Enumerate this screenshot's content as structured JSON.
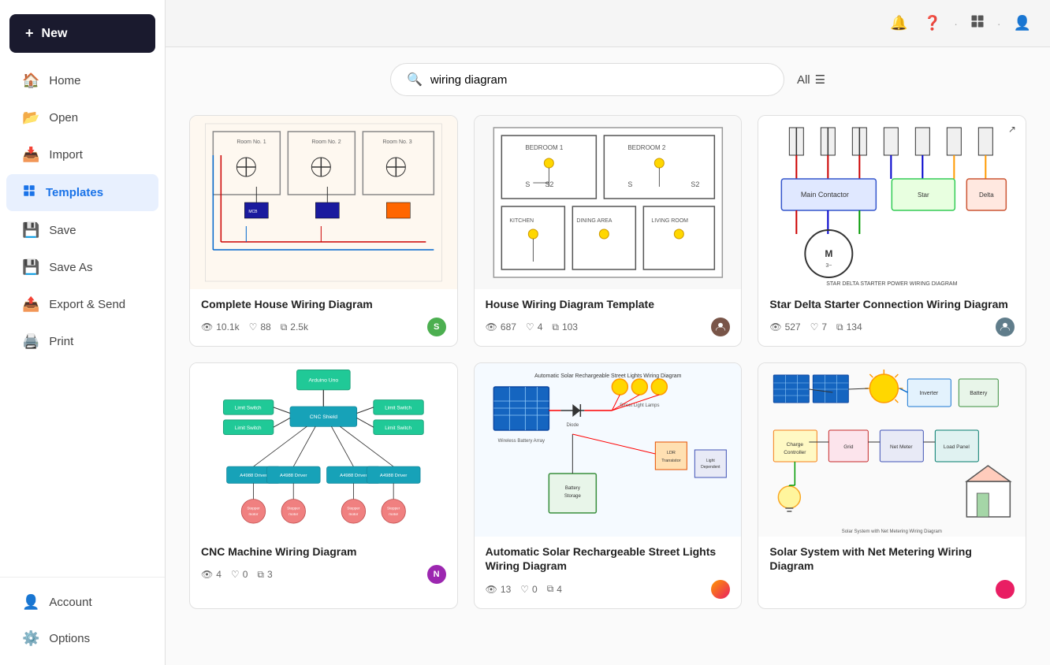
{
  "sidebar": {
    "new_label": "New",
    "items": [
      {
        "id": "home",
        "label": "Home",
        "icon": "🏠",
        "active": false
      },
      {
        "id": "open",
        "label": "Open",
        "icon": "📂",
        "active": false
      },
      {
        "id": "import",
        "label": "Import",
        "icon": "📥",
        "active": false
      },
      {
        "id": "templates",
        "label": "Templates",
        "icon": "📋",
        "active": true
      },
      {
        "id": "save",
        "label": "Save",
        "icon": "💾",
        "active": false
      },
      {
        "id": "save-as",
        "label": "Save As",
        "icon": "💾",
        "active": false
      },
      {
        "id": "export",
        "label": "Export & Send",
        "icon": "📤",
        "active": false
      },
      {
        "id": "print",
        "label": "Print",
        "icon": "🖨️",
        "active": false
      }
    ],
    "bottom_items": [
      {
        "id": "account",
        "label": "Account",
        "icon": "👤"
      },
      {
        "id": "options",
        "label": "Options",
        "icon": "⚙️"
      }
    ]
  },
  "topbar": {
    "notification_icon": "🔔",
    "help_icon": "❓",
    "apps_icon": "⊞",
    "user_icon": "👤"
  },
  "search": {
    "placeholder": "wiring diagram",
    "filter_label": "All",
    "filter_icon": "☰"
  },
  "templates": [
    {
      "id": 1,
      "title": "Complete House Wiring Diagram",
      "views": "10.1k",
      "likes": "88",
      "copies": "2.5k",
      "avatar_color": "#4caf50",
      "avatar_text": "S",
      "bg": "#fef8f0"
    },
    {
      "id": 2,
      "title": "House Wiring Diagram Template",
      "views": "687",
      "likes": "4",
      "copies": "103",
      "avatar_color": "#795548",
      "avatar_text": "",
      "bg": "#f8f8f8"
    },
    {
      "id": 3,
      "title": "Star Delta Starter Connection Wiring Diagram",
      "views": "527",
      "likes": "7",
      "copies": "134",
      "avatar_color": "#607d8b",
      "avatar_text": "",
      "bg": "#ffffff"
    },
    {
      "id": 4,
      "title": "CNC Machine Wiring Diagram",
      "views": "4",
      "likes": "0",
      "copies": "3",
      "avatar_color": "#9c27b0",
      "avatar_text": "N",
      "bg": "#ffffff"
    },
    {
      "id": 5,
      "title": "Automatic Solar Rechargeable Street Lights Wiring Diagram",
      "views": "13",
      "likes": "0",
      "copies": "4",
      "avatar_color": "#ff9800",
      "avatar_text": "",
      "bg": "#f5faff"
    },
    {
      "id": 6,
      "title": "Solar System with Net Metering Wiring Diagram",
      "views": "",
      "likes": "",
      "copies": "",
      "avatar_color": "#e91e63",
      "avatar_text": "",
      "bg": "#fafafa"
    }
  ]
}
